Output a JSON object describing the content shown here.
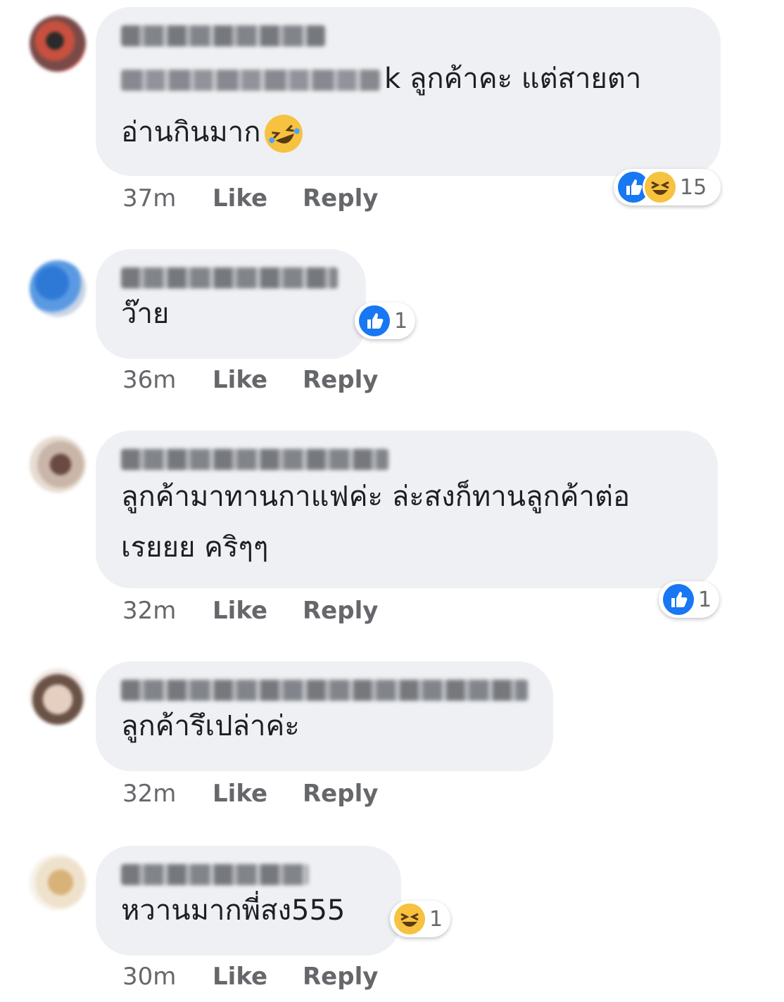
{
  "comments": [
    {
      "author_hidden": true,
      "text_mentioned_suffix": "k ลูกค้าคะ แต่สายตา",
      "text_line2": "อ่านกินมาก",
      "time": "37m",
      "like": "Like",
      "reply": "Reply",
      "reactions": [
        "like-icon",
        "haha-icon"
      ],
      "reaction_count": "15"
    },
    {
      "author_hidden": true,
      "text": "ว๊าย",
      "time": "36m",
      "like": "Like",
      "reply": "Reply",
      "reactions": [
        "like-icon"
      ],
      "reaction_count": "1"
    },
    {
      "author_hidden": true,
      "text": "ลูกค้ามาทานกาแฟค่ะ ล่ะสงก็ทานลูกค้าต่อ เรยยย คริๆๆ",
      "time": "32m",
      "like": "Like",
      "reply": "Reply",
      "reactions": [
        "like-icon"
      ],
      "reaction_count": "1"
    },
    {
      "author_hidden": true,
      "text": "ลูกค้ารึเปล่าค่ะ",
      "time": "32m",
      "like": "Like",
      "reply": "Reply"
    },
    {
      "author_hidden": true,
      "text": "หวานมากพี่สง555",
      "time": "30m",
      "like": "Like",
      "reply": "Reply",
      "reactions": [
        "haha-icon"
      ],
      "reaction_count": "1"
    }
  ],
  "colors": {
    "bubble": "#eff0f3",
    "like_blue": "#1877f2",
    "haha_yellow": "#f7c23f",
    "meta_gray": "#65676b"
  }
}
